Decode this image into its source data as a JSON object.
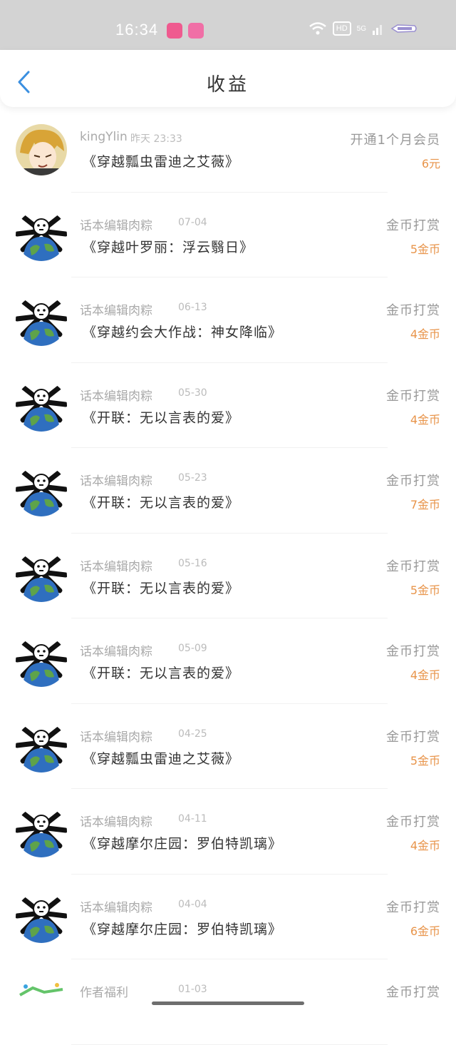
{
  "status_bar": {
    "time": "16:34",
    "hd": "HD",
    "network": "5G"
  },
  "header": {
    "title": "收益"
  },
  "records": [
    {
      "name": "kingYlin",
      "date": "昨天 23:33",
      "book": "《穿越瓢虫雷迪之艾薇》",
      "type": "开通1个月会员",
      "amount": "6元",
      "avatar": "anime-avatar"
    },
    {
      "name": "话本编辑肉粽",
      "date": "07-04",
      "book": "《穿越叶罗丽：浮云翳日》",
      "type": "金币打赏",
      "amount": "5金币",
      "avatar": "meme-earth-avatar"
    },
    {
      "name": "话本编辑肉粽",
      "date": "06-13",
      "book": "《穿越约会大作战：神女降临》",
      "type": "金币打赏",
      "amount": "4金币",
      "avatar": "meme-earth-avatar"
    },
    {
      "name": "话本编辑肉粽",
      "date": "05-30",
      "book": "《开联：无以言表的爱》",
      "type": "金币打赏",
      "amount": "4金币",
      "avatar": "meme-earth-avatar"
    },
    {
      "name": "话本编辑肉粽",
      "date": "05-23",
      "book": "《开联：无以言表的爱》",
      "type": "金币打赏",
      "amount": "7金币",
      "avatar": "meme-earth-avatar"
    },
    {
      "name": "话本编辑肉粽",
      "date": "05-16",
      "book": "《开联：无以言表的爱》",
      "type": "金币打赏",
      "amount": "5金币",
      "avatar": "meme-earth-avatar"
    },
    {
      "name": "话本编辑肉粽",
      "date": "05-09",
      "book": "《开联：无以言表的爱》",
      "type": "金币打赏",
      "amount": "4金币",
      "avatar": "meme-earth-avatar"
    },
    {
      "name": "话本编辑肉粽",
      "date": "04-25",
      "book": "《穿越瓢虫雷迪之艾薇》",
      "type": "金币打赏",
      "amount": "5金币",
      "avatar": "meme-earth-avatar"
    },
    {
      "name": "话本编辑肉粽",
      "date": "04-11",
      "book": "《穿越摩尔庄园：罗伯特凯璃》",
      "type": "金币打赏",
      "amount": "4金币",
      "avatar": "meme-earth-avatar"
    },
    {
      "name": "话本编辑肉粽",
      "date": "04-04",
      "book": "《穿越摩尔庄园：罗伯特凯璃》",
      "type": "金币打赏",
      "amount": "6金币",
      "avatar": "meme-earth-avatar"
    },
    {
      "name": "作者福利",
      "date": "01-03",
      "book": "",
      "type": "金币打赏",
      "amount": "",
      "avatar": "landscape-avatar"
    }
  ]
}
